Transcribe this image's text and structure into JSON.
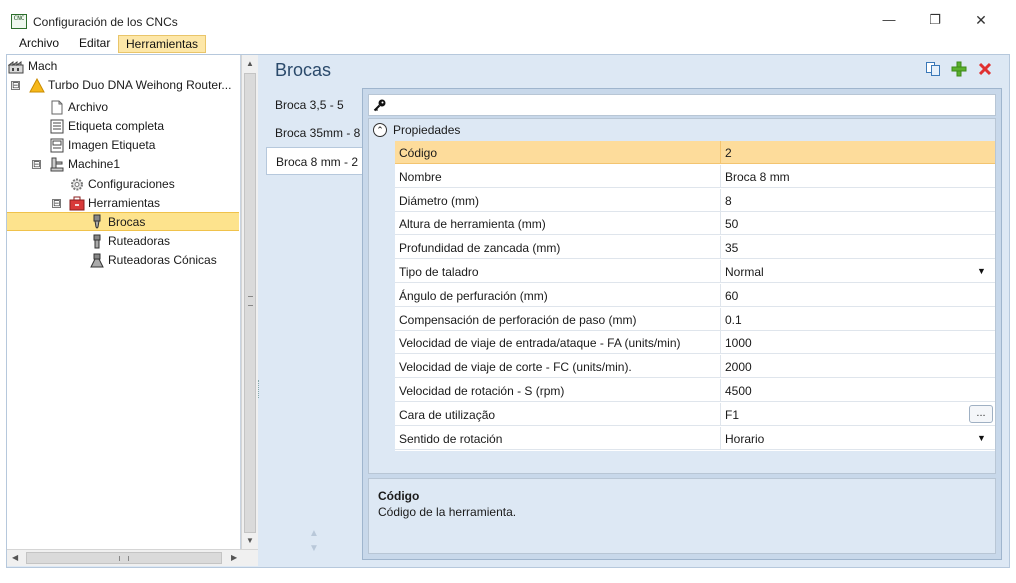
{
  "window": {
    "icon_text": "CNC",
    "title": "Configuración de los CNCs",
    "minimize": "—",
    "maximize": "❐",
    "close": "✕"
  },
  "menu": [
    "Archivo",
    "Editar",
    "Herramientas"
  ],
  "tree": [
    {
      "label": "Mach"
    },
    {
      "label": "Turbo Duo DNA Weihong Router...",
      "expander": "⊟"
    },
    {
      "label": "Archivo"
    },
    {
      "label": "Etiqueta completa"
    },
    {
      "label": "Imagen Etiqueta"
    },
    {
      "label": "Machine1",
      "expander": "⊟"
    },
    {
      "label": "Configuraciones"
    },
    {
      "label": "Herramientas",
      "expander": "⊟"
    },
    {
      "label": "Brocas",
      "selected": true
    },
    {
      "label": "Ruteadoras"
    },
    {
      "label": "Ruteadoras Cónicas"
    }
  ],
  "section": {
    "title": "Brocas"
  },
  "tabs": [
    {
      "label": "Broca 3,5 - 5"
    },
    {
      "label": "Broca 35mm - 8"
    },
    {
      "label": "Broca 8 mm - 2",
      "active": true
    }
  ],
  "property_grid": {
    "search_value": "",
    "category": "Propiedades",
    "rows": [
      {
        "name": "Código",
        "value": "2",
        "selected": true
      },
      {
        "name": "Nombre",
        "value": "Broca 8 mm"
      },
      {
        "name": "Diámetro (mm)",
        "value": "8"
      },
      {
        "name": "Altura de herramienta (mm)",
        "value": "50"
      },
      {
        "name": "Profundidad de zancada (mm)",
        "value": "35"
      },
      {
        "name": "Tipo de taladro",
        "value": "Normal",
        "dropdown": true
      },
      {
        "name": "Ángulo de perfuración (mm)",
        "value": "60"
      },
      {
        "name": "Compensación de perforación de paso (mm)",
        "value": "0.1"
      },
      {
        "name": "Velocidad de viaje de entrada/ataque - FA (units/min)",
        "value": "1000"
      },
      {
        "name": "Velocidad de viaje de corte - FC (units/min).",
        "value": "2000"
      },
      {
        "name": "Velocidad de rotación - S (rpm)",
        "value": "4500"
      },
      {
        "name": "Cara de utilização",
        "value": "F1",
        "ellipsis": "..."
      },
      {
        "name": "Sentido de rotación",
        "value": "Horario",
        "dropdown": true
      }
    ],
    "description": {
      "title": "Código",
      "text": "Código de la herramienta."
    }
  },
  "colors": {
    "accent_selection": "#fddc9b",
    "panel_background": "#dde8f4",
    "title_text": "#2b4a6b",
    "add_icon": "#5bb02e",
    "delete_icon": "#e03030"
  }
}
